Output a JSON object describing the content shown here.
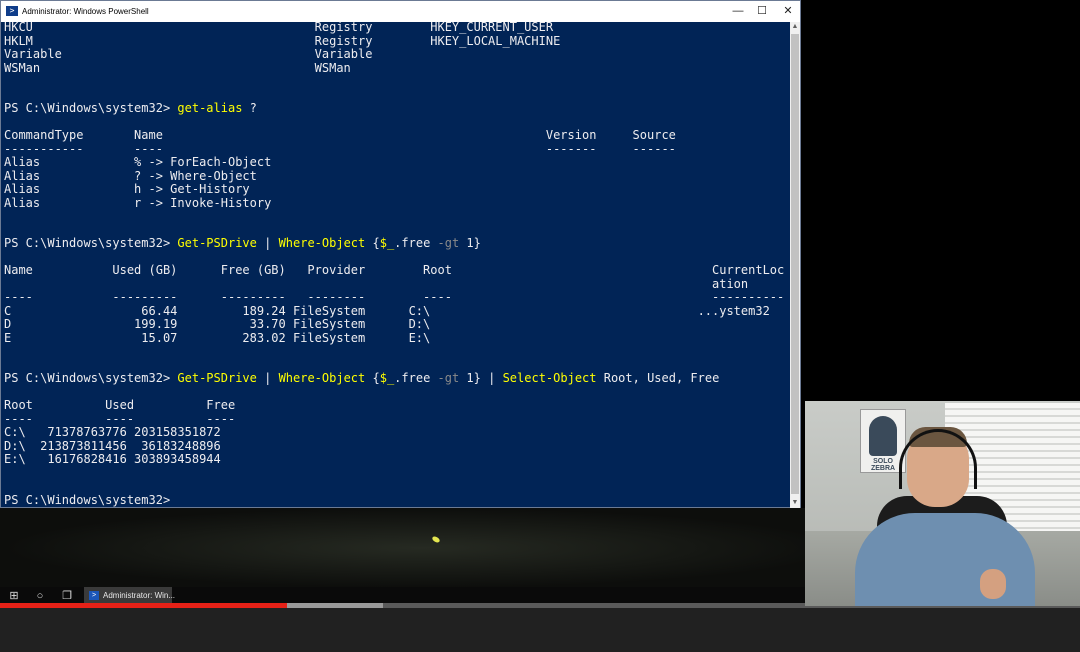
{
  "window": {
    "title": "Administrator: Windows PowerShell",
    "controls": {
      "minimize": "—",
      "maximize": "☐",
      "close": "✕"
    }
  },
  "console": {
    "provider_rows": [
      {
        "name": "HKCU",
        "provider": "Registry",
        "root": "HKEY_CURRENT_USER"
      },
      {
        "name": "HKLM",
        "provider": "Registry",
        "root": "HKEY_LOCAL_MACHINE"
      },
      {
        "name": "Variable",
        "provider": "Variable",
        "root": ""
      },
      {
        "name": "WSMan",
        "provider": "WSMan",
        "root": ""
      }
    ],
    "prompt": "PS C:\\Windows\\system32> ",
    "cmd1": "get-alias ?",
    "alias_headers": {
      "commandtype": "CommandType",
      "name": "Name",
      "version": "Version",
      "source": "Source"
    },
    "alias_rows": [
      {
        "type": "Alias",
        "name": "% -> ForEach-Object"
      },
      {
        "type": "Alias",
        "name": "? -> Where-Object"
      },
      {
        "type": "Alias",
        "name": "h -> Get-History"
      },
      {
        "type": "Alias",
        "name": "r -> Invoke-History"
      }
    ],
    "cmd2": {
      "a": "Get-PSDrive",
      "pipe": "|",
      "b": "Where-Object",
      "brace_open": "{",
      "var": "$_",
      "prop": ".free",
      "op": "-gt",
      "num": "1",
      "brace_close": "}"
    },
    "drive_headers": {
      "name": "Name",
      "used": "Used (GB)",
      "free": "Free (GB)",
      "provider": "Provider",
      "root": "Root",
      "curloc1": "CurrentLoc",
      "curloc2": "ation"
    },
    "drive_rows": [
      {
        "name": "C",
        "used": "66.44",
        "free": "189.24",
        "provider": "FileSystem",
        "root": "C:\\",
        "curloc": "...ystem32"
      },
      {
        "name": "D",
        "used": "199.19",
        "free": "33.70",
        "provider": "FileSystem",
        "root": "D:\\",
        "curloc": ""
      },
      {
        "name": "E",
        "used": "15.07",
        "free": "283.02",
        "provider": "FileSystem",
        "root": "E:\\",
        "curloc": ""
      }
    ],
    "cmd3": {
      "c": "Select-Object",
      "args": "Root, Used, Free"
    },
    "select_headers": {
      "root": "Root",
      "used": "Used",
      "free": "Free"
    },
    "select_rows": [
      {
        "root": "C:\\",
        "used": "71378763776",
        "free": "203158351872"
      },
      {
        "root": "D:\\",
        "used": "213873811456",
        "free": "36183248896"
      },
      {
        "root": "E:\\",
        "used": "16176828416",
        "free": "303893458944"
      }
    ]
  },
  "taskbar": {
    "start_icon": "windows-logo",
    "ps_task_label": "Administrator: Win..."
  },
  "video": {
    "progress_played": 0.266,
    "progress_buffered": 0.355
  },
  "webcam": {
    "poster_text": "SOLO ZEBRA"
  }
}
